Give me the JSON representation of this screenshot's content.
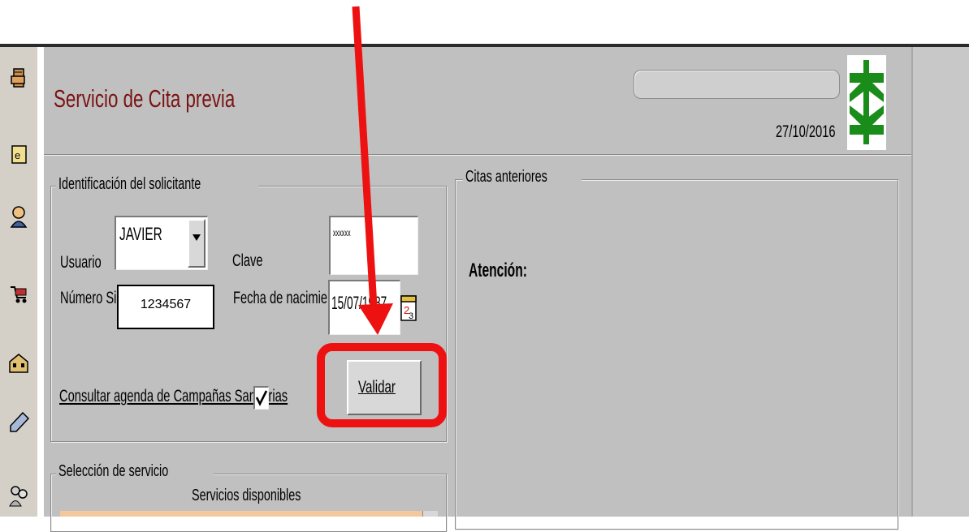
{
  "header": {
    "title": "Servicio de Cita previa",
    "date": "27/10/2016"
  },
  "identificacion": {
    "title": "Identificación del solicitante",
    "usuario_label": "Usuario",
    "usuario_value": "JAVIER",
    "clave_label": "Clave",
    "clave_value": "xxxxxx",
    "sip_label": "Número Sip",
    "sip_value": "1234567",
    "fecha_label": "Fecha de nacimiento",
    "fecha_value": "15/07/1987",
    "campanas_label": "Consultar agenda de Campañas Sanitarias",
    "campanas_checked": true,
    "validar_label": "Validar"
  },
  "citas": {
    "title": "Citas anteriores",
    "atencion": "Atención:"
  },
  "seleccion": {
    "title": "Selección de servicio",
    "servicios_label": "Servicios disponibles"
  },
  "sidebar": {
    "icons": [
      "hand-document-icon",
      "document-e-icon",
      "person-icon",
      "shopping-cart-icon",
      "building-icon",
      "pen-icon",
      "people-icon"
    ]
  },
  "annotation": {
    "arrow_color": "#ee1111",
    "highlight_color": "#ee1111"
  }
}
